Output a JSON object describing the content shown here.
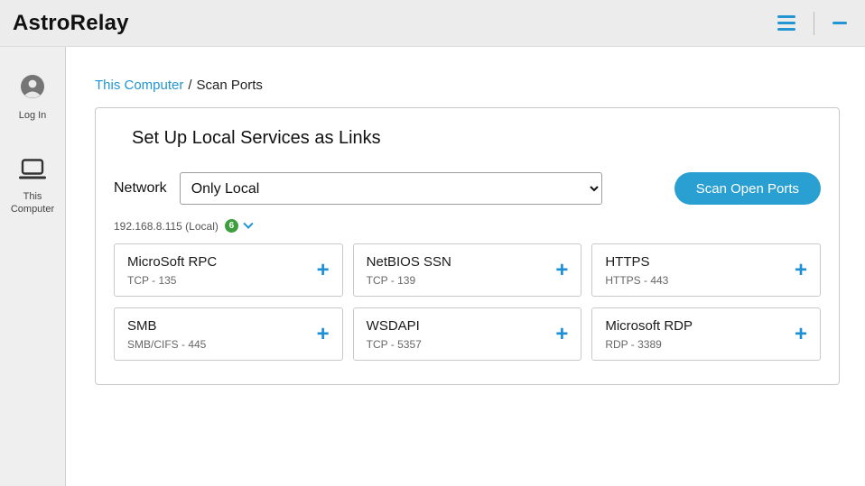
{
  "header": {
    "app_title": "AstroRelay"
  },
  "sidebar": {
    "items": [
      {
        "label": "Log In",
        "icon": "user-avatar-icon"
      },
      {
        "label": "This Computer",
        "icon": "computer-icon"
      }
    ]
  },
  "breadcrumb": {
    "link": "This Computer",
    "separator": "/",
    "current": "Scan Ports"
  },
  "panel": {
    "title": "Set Up Local Services as Links",
    "network_label": "Network",
    "network_select_value": "Only Local",
    "scan_button_label": "Scan Open Ports",
    "ip_label": "192.168.8.115 (Local)",
    "open_port_count": "6",
    "services": [
      {
        "name": "MicroSoft RPC",
        "detail": "TCP - 135"
      },
      {
        "name": "NetBIOS SSN",
        "detail": "TCP - 139"
      },
      {
        "name": "HTTPS",
        "detail": "HTTPS - 443"
      },
      {
        "name": "SMB",
        "detail": "SMB/CIFS - 445"
      },
      {
        "name": "WSDAPI",
        "detail": "TCP - 5357"
      },
      {
        "name": "Microsoft RDP",
        "detail": "RDP - 3389"
      }
    ]
  },
  "icons": {
    "plus": "+"
  },
  "colors": {
    "accent_blue": "#2196d3",
    "button_blue": "#2aa0d2",
    "badge_green": "#3c9e3c"
  }
}
